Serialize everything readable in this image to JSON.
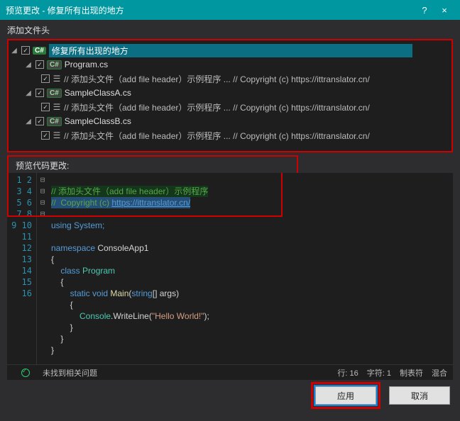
{
  "titlebar": {
    "title": "预览更改 - 修复所有出现的地方",
    "help": "?",
    "close": "×"
  },
  "section_add_header": "添加文件头",
  "tree": {
    "root_badge": "C#",
    "root_label": "修复所有出现的地方",
    "files": [
      {
        "name": "Program.cs",
        "detail": "// 添加头文件（add file header）示例程序 ...  //   Copyright (c) https://ittranslator.cn/"
      },
      {
        "name": "SampleClassA.cs",
        "detail": "// 添加头文件（add file header）示例程序 ...  //   Copyright (c) https://ittranslator.cn/"
      },
      {
        "name": "SampleClassB.cs",
        "detail": "// 添加头文件（add file header）示例程序 ...  //   Copyright (c) https://ittranslator.cn/"
      }
    ],
    "detail_icon": "☰"
  },
  "section_preview": "预览代码更改:",
  "code": {
    "lines": [
      "1",
      "2",
      "3",
      "4",
      "5",
      "6",
      "7",
      "8",
      "9",
      "10",
      "11",
      "12",
      "13",
      "14",
      "15",
      "16"
    ],
    "fold": [
      "⊟",
      "",
      "",
      "",
      "",
      "⊟",
      "",
      "⊟",
      "",
      "⊟",
      "",
      "",
      "",
      "",
      "",
      " "
    ],
    "l1_a": "// 添加头文件（add file header）示例程序",
    "l2_a": "//  Copyright (c) ",
    "l2_link": "https://ittranslator.cn/",
    "l4": "using System;",
    "l6a": "namespace ",
    "l6b": "ConsoleApp1",
    "l7": "{",
    "l8a": "    class ",
    "l8b": "Program",
    "l9": "    {",
    "l10a": "        static void ",
    "l10b": "Main",
    "l10c": "(",
    "l10d": "string",
    "l10e": "[] args)",
    "l11": "        {",
    "l12a": "            Console",
    "l12b": ".WriteLine(",
    "l12c": "\"Hello World!\"",
    "l12d": ");",
    "l13": "        }",
    "l14": "    }",
    "l15": "}"
  },
  "status": {
    "no_issues": "未找到相关问题",
    "line": "行: 16",
    "char": "字符: 1",
    "tab": "制表符",
    "mode": "混合"
  },
  "buttons": {
    "apply": "应用",
    "cancel": "取消"
  }
}
